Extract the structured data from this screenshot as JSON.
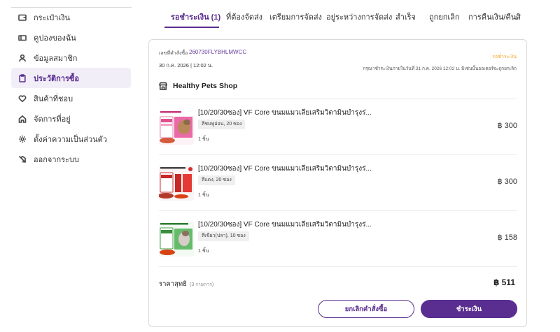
{
  "sidebar": {
    "items": [
      {
        "label": "กระเป๋าเงิน",
        "icon": "wallet-icon"
      },
      {
        "label": "คูปองของฉัน",
        "icon": "coupon-icon"
      },
      {
        "label": "ข้อมูลสมาชิก",
        "icon": "user-icon"
      },
      {
        "label": "ประวัติการซื้อ",
        "icon": "clipboard-icon",
        "active": true
      },
      {
        "label": "สินค้าที่ชอบ",
        "icon": "heart-icon"
      },
      {
        "label": "จัดการที่อยู่",
        "icon": "home-icon"
      },
      {
        "label": "ตั้งค่าความเป็นส่วนตัว",
        "icon": "gear-icon"
      },
      {
        "label": "ออกจากระบบ",
        "icon": "logout-icon"
      }
    ]
  },
  "tabs": [
    {
      "label": "รอชำระเงิน (1)",
      "active": true
    },
    {
      "label": "ที่ต้องจัดส่ง"
    },
    {
      "label": "เตรียมการจัดส่ง"
    },
    {
      "label": "อยู่ระหว่างการจัดส่ง"
    },
    {
      "label": "สำเร็จ"
    },
    {
      "label": "ถูกยกเลิก"
    },
    {
      "label": "การคืนเงิน/คืนสิ"
    }
  ],
  "order": {
    "number_label": "เลขที่คำสั่งซื้อ",
    "number": "260730FLYBHLMWCC",
    "date": "30 ก.ค. 2026 | 12:02 น.",
    "status": "รอชำระเงิน",
    "payment_note": "กรุณาชำระเงินภายในวันที่ 31 ก.ค. 2026 12:02 น. มิเช่นนั้นออเดอร์จะถูกยกเลิก",
    "shop_name": "Healthy Pets Shop",
    "items": [
      {
        "title": "[10/20/30ซอง] VF Core ขนมแมวเลียเสริมวิตามินบำรุงร่...",
        "variant": "สีชมพูอ่อน, 20 ซอง",
        "qty": "1 ชิ้น",
        "price": "฿ 300"
      },
      {
        "title": "[10/20/30ซอง] VF Core ขนมแมวเลียเสริมวิตามินบำรุงร่...",
        "variant": "สีแดง, 20 ซอง",
        "qty": "1 ชิ้น",
        "price": "฿ 300"
      },
      {
        "title": "[10/20/30ซอง] VF Core ขนมแมวเลียเสริมวิตามินบำรุงร่...",
        "variant": "สีเขียว(ปลา), 10 ซอง",
        "qty": "1 ชิ้น",
        "price": "฿ 158"
      }
    ],
    "total_label": "ราคาสุทธิ",
    "total_count": "(3 รายการ)",
    "total_value": "฿ 511",
    "cancel_label": "ยกเลิกคำสั่งซื้อ",
    "pay_label": "ชำระเงิน"
  },
  "colors": {
    "accent": "#5a2d91",
    "status": "#f5a623"
  }
}
